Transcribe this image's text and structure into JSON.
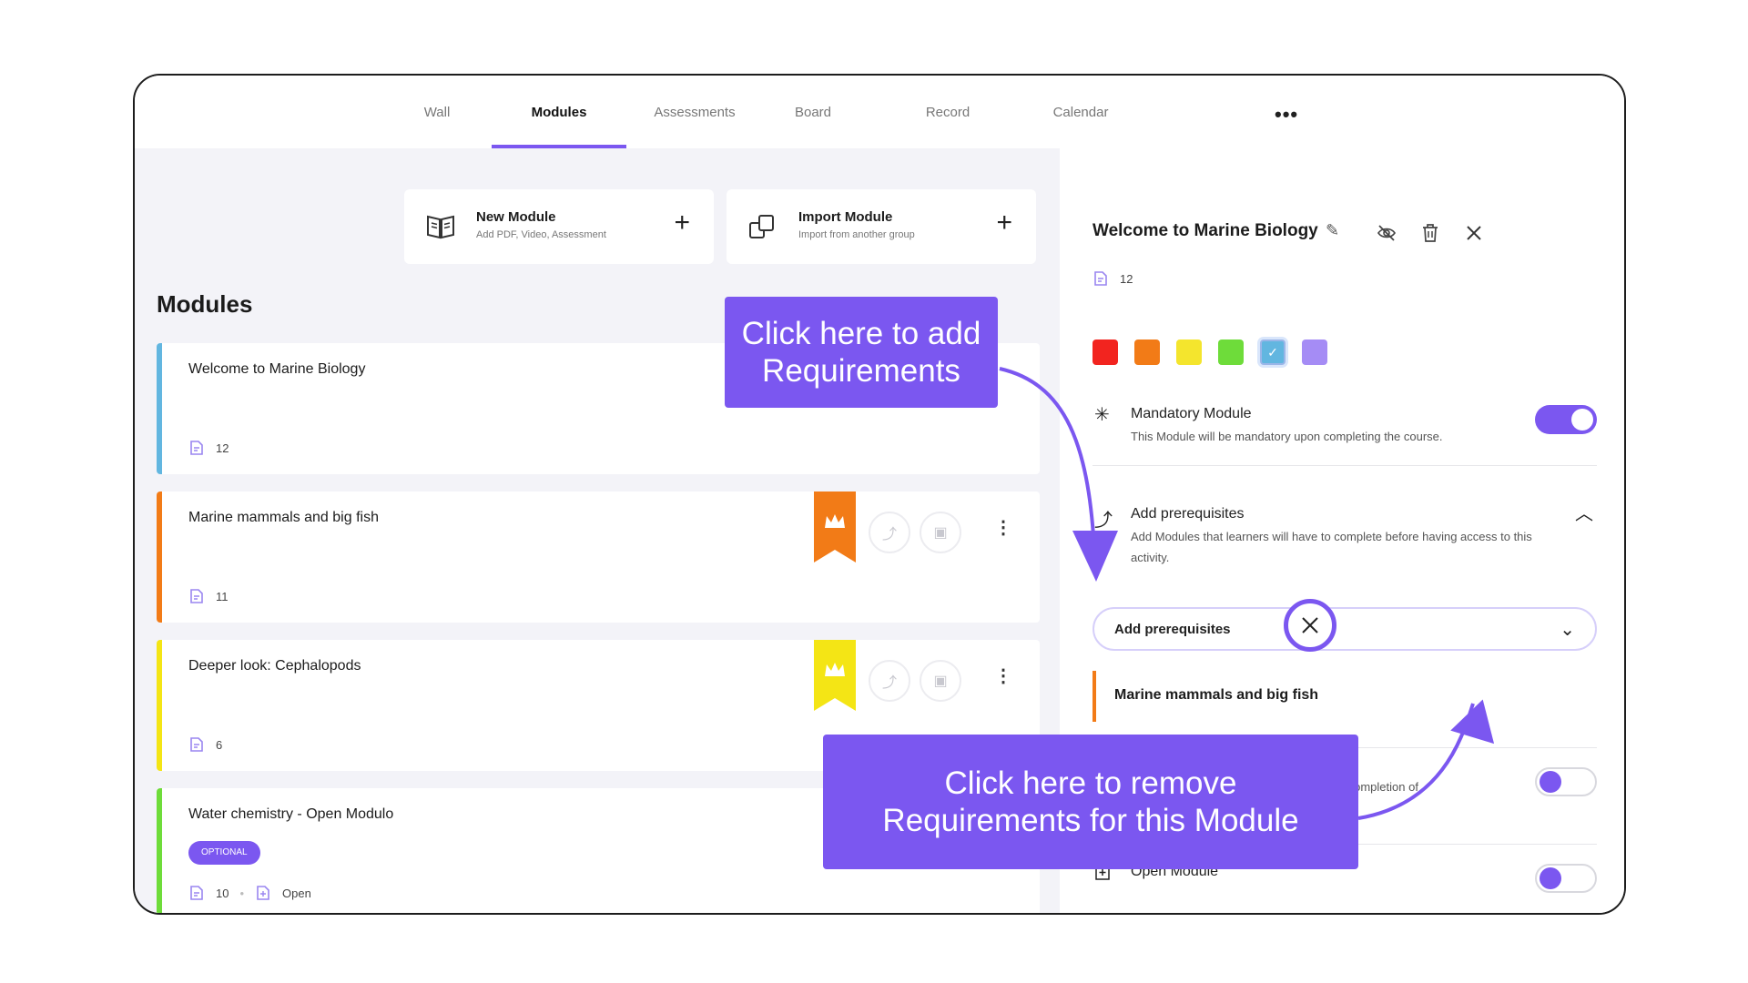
{
  "nav": {
    "tabs": [
      {
        "label": "Wall"
      },
      {
        "label": "Modules"
      },
      {
        "label": "Assessments"
      },
      {
        "label": "Board"
      },
      {
        "label": "Record"
      },
      {
        "label": "Calendar"
      }
    ],
    "more_label": "•••",
    "active_tab": "Modules"
  },
  "actions": {
    "new_module": {
      "title": "New Module",
      "subtitle": "Add PDF, Video, Assessment",
      "plus": "+"
    },
    "import_module": {
      "title": "Import Module",
      "subtitle": "Import from another group",
      "plus": "+"
    }
  },
  "modules_heading": "Modules",
  "modules": [
    {
      "title": "Welcome to Marine Biology",
      "count": "12",
      "color": "#62b6e0"
    },
    {
      "title": "Marine mammals and big fish",
      "count": "11",
      "color": "#f27b17"
    },
    {
      "title": "Deeper look: Cephalopods",
      "count": "6",
      "color": "#f4e515"
    },
    {
      "title": "Water chemistry - Open Modulo",
      "count": "10",
      "badge": "OPTIONAL",
      "extra": "Open",
      "color": "#6edc3a"
    }
  ],
  "crown_colors": [
    "#f27b17",
    "#f4e515"
  ],
  "detail": {
    "title": "Welcome to Marine Biology",
    "count": "12",
    "swatches": [
      "#f2241f",
      "#f27b17",
      "#f4e52d",
      "#6edc3a",
      "#62b6e0",
      "#a58cf5"
    ],
    "selected_swatch_index": 4,
    "mandatory": {
      "title": "Mandatory Module",
      "desc": "This Module will be mandatory upon completing the course.",
      "on": true
    },
    "prereq": {
      "title": "Add prerequisites",
      "desc": "Add Modules that learners will have to complete before having access to this activity.",
      "select_label": "Add prerequisites",
      "selected_item": "Marine mammals and big fish"
    },
    "hidden_row_desc": "ed upon completion of",
    "open_module": {
      "title": "Open Module",
      "on": false
    }
  },
  "callouts": {
    "add": "Click here to add Requirements",
    "remove": "Click here to remove Requirements for this Module"
  },
  "accent_color": "#7b57f0"
}
